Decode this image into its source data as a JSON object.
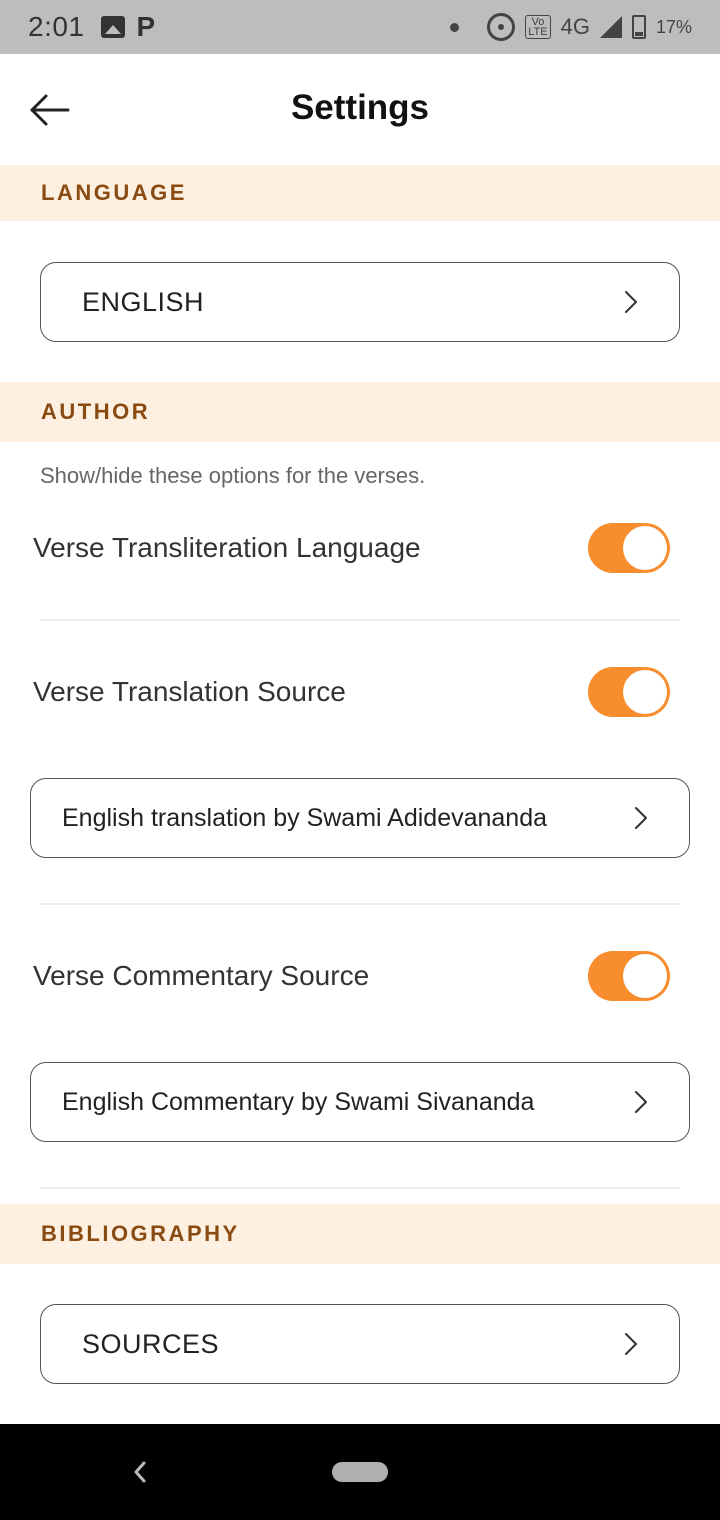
{
  "status_bar": {
    "time": "2:01",
    "network": "4G",
    "battery": "17%",
    "volte": "VoLTE"
  },
  "header": {
    "title": "Settings",
    "back_icon": "arrow-left-icon"
  },
  "language_section": {
    "title": "LANGUAGE",
    "selected": "ENGLISH"
  },
  "author_section": {
    "title": "AUTHOR",
    "description": "Show/hide these options for the verses.",
    "transliteration": {
      "label": "Verse Transliteration Language",
      "enabled": true
    },
    "translation": {
      "label": "Verse Translation Source",
      "enabled": true,
      "selected": "English translation by Swami Adidevananda"
    },
    "commentary": {
      "label": "Verse Commentary Source",
      "enabled": true,
      "selected": "English Commentary by Swami Sivananda"
    }
  },
  "bibliography_section": {
    "title": "BIBLIOGRAPHY",
    "sources_label": "SOURCES"
  },
  "colors": {
    "accent": "#f78d2d",
    "section_bg": "#fdf0e0",
    "section_text": "#8a4b12"
  }
}
